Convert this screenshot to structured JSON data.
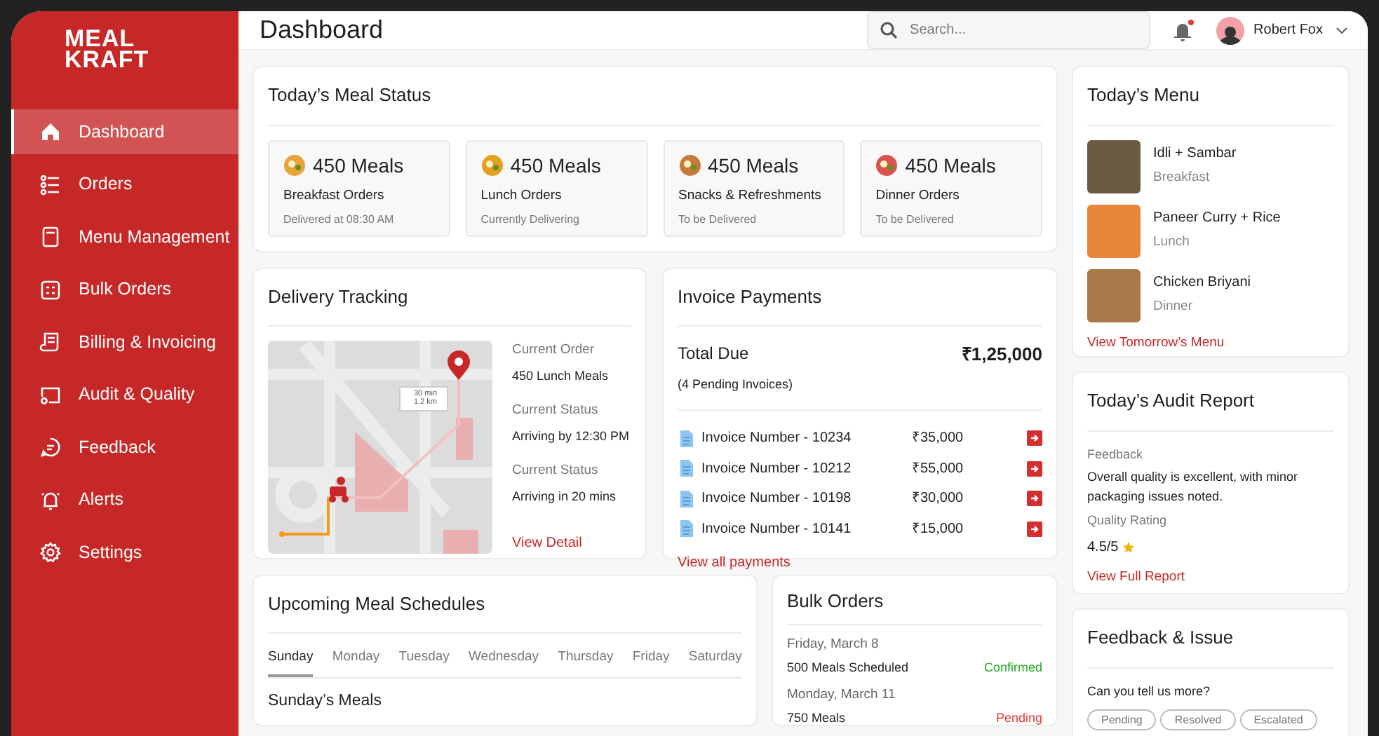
{
  "sidebar": {
    "logo": [
      "MEAL",
      "KRAFT"
    ],
    "items": [
      {
        "label": "Dashboard",
        "selected": true
      },
      {
        "label": "Orders",
        "selected": false
      },
      {
        "label": "Menu Management",
        "selected": false
      },
      {
        "label": "Bulk Orders",
        "selected": false
      },
      {
        "label": "Billing & Invoicing",
        "selected": false
      },
      {
        "label": "Audit & Quality",
        "selected": false
      },
      {
        "label": "Feedback",
        "selected": false
      },
      {
        "label": "Alerts",
        "selected": false
      },
      {
        "label": "Settings",
        "selected": false
      }
    ]
  },
  "header": {
    "title": "Dashboard",
    "search": {
      "placeholder": "Search..."
    },
    "notification_dot": true,
    "user": "Robert Fox"
  },
  "meal_status": {
    "title": "Today’s Meal Status",
    "cards": [
      {
        "count": "450 Meals",
        "label": "Breakfast Orders",
        "status": "Delivered at 08:30 AM"
      },
      {
        "count": "450 Meals",
        "label": "Lunch Orders",
        "status": "Currently Delivering"
      },
      {
        "count": "450 Meals",
        "label": "Snacks & Refreshments",
        "status": "To be Delivered"
      },
      {
        "count": "450 Meals",
        "label": "Dinner Orders",
        "status": "To be Delivered"
      }
    ]
  },
  "delivery": {
    "title": "Delivery Tracking",
    "map_label": [
      "30 min",
      "1.2 km"
    ],
    "details": [
      {
        "label": "Current Order",
        "value": "450 Lunch Meals"
      },
      {
        "label": "Current Status",
        "value": "Arriving by 12:30 PM"
      },
      {
        "label": "Current Status",
        "value": "Arriving in 20 mins"
      }
    ],
    "link": "View Detail"
  },
  "invoices": {
    "title": "Invoice Payments",
    "total_label": "Total Due",
    "total": "₹1,25,000",
    "pending": "(4 Pending Invoices)",
    "rows": [
      {
        "name": "Invoice Number - 10234",
        "amount": "₹35,000"
      },
      {
        "name": "Invoice Number - 10212",
        "amount": "₹55,000"
      },
      {
        "name": "Invoice Number - 10198",
        "amount": "₹30,000"
      },
      {
        "name": "Invoice Number - 10141",
        "amount": "₹15,000"
      }
    ],
    "link": "View all payments"
  },
  "schedules": {
    "title": "Upcoming Meal Schedules",
    "tabs": [
      {
        "label": "Sunday",
        "selected": true
      },
      {
        "label": "Monday",
        "selected": false
      },
      {
        "label": "Tuesday",
        "selected": false
      },
      {
        "label": "Wednesday",
        "selected": false
      },
      {
        "label": "Thursday",
        "selected": false
      },
      {
        "label": "Friday",
        "selected": false
      },
      {
        "label": "Saturday",
        "selected": false
      }
    ],
    "subtitle": "Sunday’s Meals"
  },
  "bulk_orders": {
    "title": "Bulk Orders",
    "rows": [
      {
        "date": "Friday, March 8",
        "meals": "500 Meals Scheduled",
        "status": "Confirmed",
        "color": "#22a722"
      },
      {
        "date": "Monday, March 11",
        "meals": "750 Meals",
        "status": "Pending",
        "color": "#e53935"
      }
    ]
  },
  "todays_menu": {
    "title": "Today’s Menu",
    "items": [
      {
        "name": "Idli + Sambar",
        "meal": "Breakfast"
      },
      {
        "name": "Paneer Curry + Rice",
        "meal": "Lunch"
      },
      {
        "name": "Chicken Briyani",
        "meal": "Dinner"
      }
    ],
    "link": "View Tomorrow’s Menu"
  },
  "audit": {
    "title": "Today’s Audit Report",
    "feedback_label": "Feedback",
    "feedback": "Overall quality is excellent, with minor packaging issues noted.",
    "rating_label": "Quality Rating",
    "rating": "4.5/5",
    "link": "View Full Report"
  },
  "feedback_issue": {
    "title": "Feedback & Issue",
    "question": "Can you tell us more?",
    "chips": [
      "Pending",
      "Resolved",
      "Escalated"
    ]
  }
}
